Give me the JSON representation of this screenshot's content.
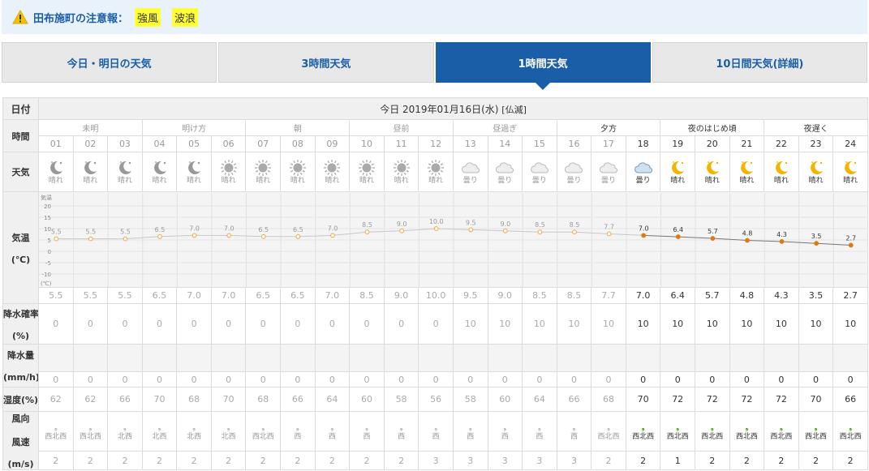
{
  "alert": {
    "title": "田布施町の注意報：",
    "items": [
      "強風",
      "波浪"
    ]
  },
  "tabs": [
    "今日・明日の天気",
    "3時間天気",
    "1時間天気",
    "10日間天気(詳細)"
  ],
  "active_tab": 2,
  "labels": {
    "date": "日付",
    "time": "時間",
    "weather": "天気",
    "temp_1": "気温",
    "temp_2": "(℃)",
    "pop_1": "降水確率",
    "pop_2": "(%)",
    "precip_1": "降水量",
    "precip_2": "(mm/h)",
    "humidity": "湿度(%)",
    "wind_dir": "風向",
    "wind_speed": "風速",
    "wind_unit": "(m/s)"
  },
  "date": {
    "text": "今日 2019年01月16日(水)",
    "rokuyo": "[仏滅]"
  },
  "periods": [
    {
      "label": "未明",
      "span": 3,
      "active": false
    },
    {
      "label": "明け方",
      "span": 3,
      "active": false
    },
    {
      "label": "朝",
      "span": 3,
      "active": false
    },
    {
      "label": "昼前",
      "span": 3,
      "active": false
    },
    {
      "label": "昼過ぎ",
      "span": 3,
      "active": false
    },
    {
      "label": "夕方",
      "span": 3,
      "active": true
    },
    {
      "label": "夜のはじめ頃",
      "span": 3,
      "active": true
    },
    {
      "label": "夜遅く",
      "span": 3,
      "active": true
    }
  ],
  "hours": [
    "01",
    "02",
    "03",
    "04",
    "05",
    "06",
    "07",
    "08",
    "09",
    "10",
    "11",
    "12",
    "13",
    "14",
    "15",
    "16",
    "17",
    "18",
    "19",
    "20",
    "21",
    "22",
    "23",
    "24"
  ],
  "current_index": 17,
  "weather_labels": [
    "晴れ",
    "晴れ",
    "晴れ",
    "晴れ",
    "晴れ",
    "晴れ",
    "晴れ",
    "晴れ",
    "晴れ",
    "晴れ",
    "晴れ",
    "晴れ",
    "曇り",
    "曇り",
    "曇り",
    "曇り",
    "曇り",
    "曇り",
    "晴れ",
    "晴れ",
    "晴れ",
    "晴れ",
    "晴れ",
    "晴れ"
  ],
  "weather_icons": [
    "moon-icon",
    "moon-icon",
    "moon-icon",
    "moon-icon",
    "moon-icon",
    "sun-icon",
    "sun-icon",
    "sun-icon",
    "sun-icon",
    "sun-icon",
    "sun-icon",
    "sun-icon",
    "cloud-icon",
    "cloud-icon",
    "cloud-icon",
    "cloud-icon",
    "cloud-icon",
    "cloud-icon",
    "moon-icon",
    "moon-icon",
    "moon-icon",
    "moon-icon",
    "moon-icon",
    "moon-icon"
  ],
  "temperature_text": [
    "5.5",
    "5.5",
    "5.5",
    "6.5",
    "7.0",
    "7.0",
    "6.5",
    "6.5",
    "7.0",
    "8.5",
    "9.0",
    "10.0",
    "9.5",
    "9.0",
    "8.5",
    "8.5",
    "7.7",
    "7.0",
    "6.4",
    "5.7",
    "4.8",
    "4.3",
    "3.5",
    "2.7"
  ],
  "chart_data": {
    "type": "line",
    "x": [
      "01",
      "02",
      "03",
      "04",
      "05",
      "06",
      "07",
      "08",
      "09",
      "10",
      "11",
      "12",
      "13",
      "14",
      "15",
      "16",
      "17",
      "18",
      "19",
      "20",
      "21",
      "22",
      "23",
      "24"
    ],
    "series": [
      {
        "values": [
          5.5,
          5.5,
          5.5,
          6.5,
          7.0,
          7.0,
          6.5,
          6.5,
          7.0,
          8.5,
          9.0,
          10.0,
          9.5,
          9.0,
          8.5,
          8.5,
          7.7,
          7.0,
          6.4,
          5.7,
          4.8,
          4.3,
          3.5,
          2.7
        ]
      }
    ],
    "ylim": [
      -10,
      20
    ],
    "yticks": [
      "20",
      "15",
      "10",
      "5",
      "0",
      "-5",
      "-10"
    ],
    "ylabel_top": "気温",
    "yunit": "(℃)",
    "grid": true,
    "past_color": "#f4a640",
    "future_color": "#e07a10"
  },
  "pop": [
    "0",
    "0",
    "0",
    "0",
    "0",
    "0",
    "0",
    "0",
    "0",
    "0",
    "0",
    "0",
    "10",
    "10",
    "10",
    "10",
    "10",
    "10",
    "10",
    "10",
    "10",
    "10",
    "10",
    "10"
  ],
  "precip": [
    "0",
    "0",
    "0",
    "0",
    "0",
    "0",
    "0",
    "0",
    "0",
    "0",
    "0",
    "0",
    "0",
    "0",
    "0",
    "0",
    "0",
    "0",
    "0",
    "0",
    "0",
    "0",
    "0",
    "0"
  ],
  "humidity": [
    "62",
    "62",
    "66",
    "70",
    "68",
    "70",
    "68",
    "66",
    "64",
    "60",
    "58",
    "56",
    "58",
    "60",
    "64",
    "66",
    "68",
    "70",
    "72",
    "72",
    "72",
    "72",
    "70",
    "66"
  ],
  "wind_dir": [
    "西北西",
    "西北西",
    "北西",
    "北西",
    "北西",
    "北西",
    "西北西",
    "西",
    "西",
    "西",
    "西",
    "西",
    "西",
    "西",
    "西",
    "西",
    "西北西",
    "西北西",
    "西北西",
    "西北西",
    "西北西",
    "西北西",
    "西北西",
    "西北西"
  ],
  "wind_speed": [
    "2",
    "2",
    "2",
    "2",
    "2",
    "2",
    "2",
    "2",
    "2",
    "2",
    "2",
    "3",
    "3",
    "3",
    "3",
    "3",
    "2",
    "2",
    "1",
    "2",
    "2",
    "2",
    "2",
    "2"
  ],
  "colors": {
    "brand": "#1a5ea8",
    "alert_bg": "#e9f2fa",
    "badge": "#ffff33",
    "wind_active": "#5a9e1a"
  }
}
